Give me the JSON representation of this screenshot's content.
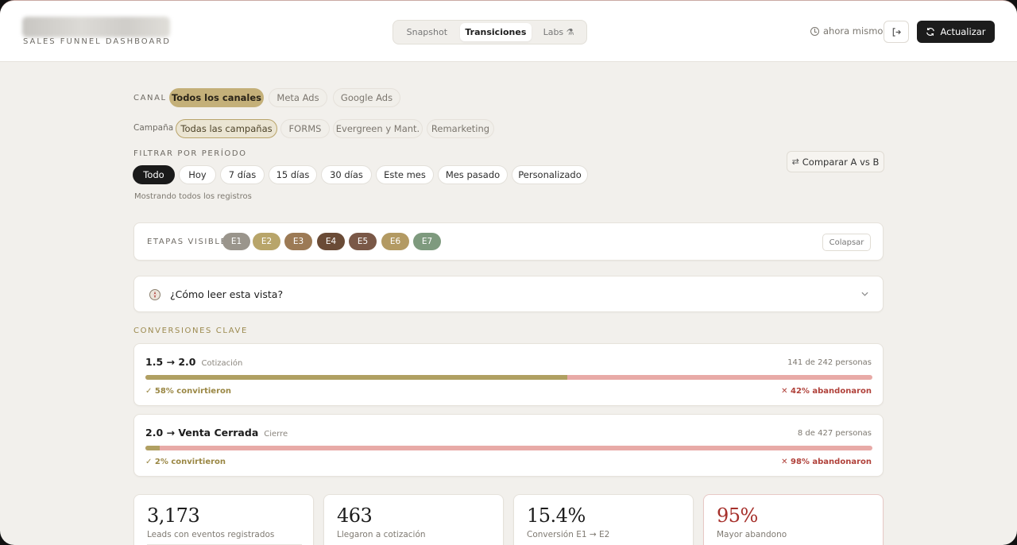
{
  "header": {
    "subtitle": "SALES FUNNEL DASHBOARD",
    "tabs": [
      {
        "label": "Snapshot",
        "active": false
      },
      {
        "label": "Transiciones",
        "active": true
      },
      {
        "label": "Labs ⚗",
        "active": false
      }
    ],
    "updated": "ahora mismo",
    "refresh_label": "Actualizar"
  },
  "filters": {
    "canal_label": "CANAL",
    "canal_options": [
      "Todos los canales",
      "Meta Ads",
      "Google Ads"
    ],
    "campana_label": "Campaña",
    "campana_options": [
      "Todas las campañas",
      "FORMS",
      "Evergreen y Mant.",
      "Remarketing"
    ],
    "periodo_label": "FILTRAR POR PERÍODO",
    "periodo_options": [
      "Todo",
      "Hoy",
      "7 días",
      "15 días",
      "30 días",
      "Este mes",
      "Mes pasado",
      "Personalizado"
    ],
    "periodo_note": "Mostrando todos los registros",
    "compare_label": "Comparar A vs B"
  },
  "stages": {
    "label": "ETAPAS VISIBLES",
    "items": [
      {
        "label": "E1",
        "color": "#9a958c"
      },
      {
        "label": "E2",
        "color": "#b8a56a"
      },
      {
        "label": "E3",
        "color": "#9c7a55"
      },
      {
        "label": "E4",
        "color": "#6a4b36"
      },
      {
        "label": "E5",
        "color": "#7a5847"
      },
      {
        "label": "E6",
        "color": "#b39a63"
      },
      {
        "label": "E7",
        "color": "#7e9a7e"
      }
    ],
    "collapse_label": "Colapsar"
  },
  "help": {
    "title": "¿Cómo leer esta vista?"
  },
  "conversions": {
    "heading": "CONVERSIONES CLAVE",
    "items": [
      {
        "from_to": "1.5 → 2.0",
        "tag": "Cotización",
        "count": "141 de 242 personas",
        "converted": "✓ 58% convirtieron",
        "abandoned": "✕ 42% abandonaron",
        "rate": 0.58
      },
      {
        "from_to": "2.0 → Venta Cerrada",
        "tag": "Cierre",
        "count": "8 de 427 personas",
        "converted": "✓ 2% convirtieron",
        "abandoned": "✕ 98% abandonaron",
        "rate": 0.02
      }
    ]
  },
  "kpis": [
    {
      "value": "3,173",
      "label": "Leads con eventos registrados"
    },
    {
      "value": "463",
      "label": "Llegaron a cotización"
    },
    {
      "value": "15.4%",
      "label": "Conversión E1 → E2"
    },
    {
      "value": "95%",
      "label": "Mayor abandono"
    }
  ]
}
